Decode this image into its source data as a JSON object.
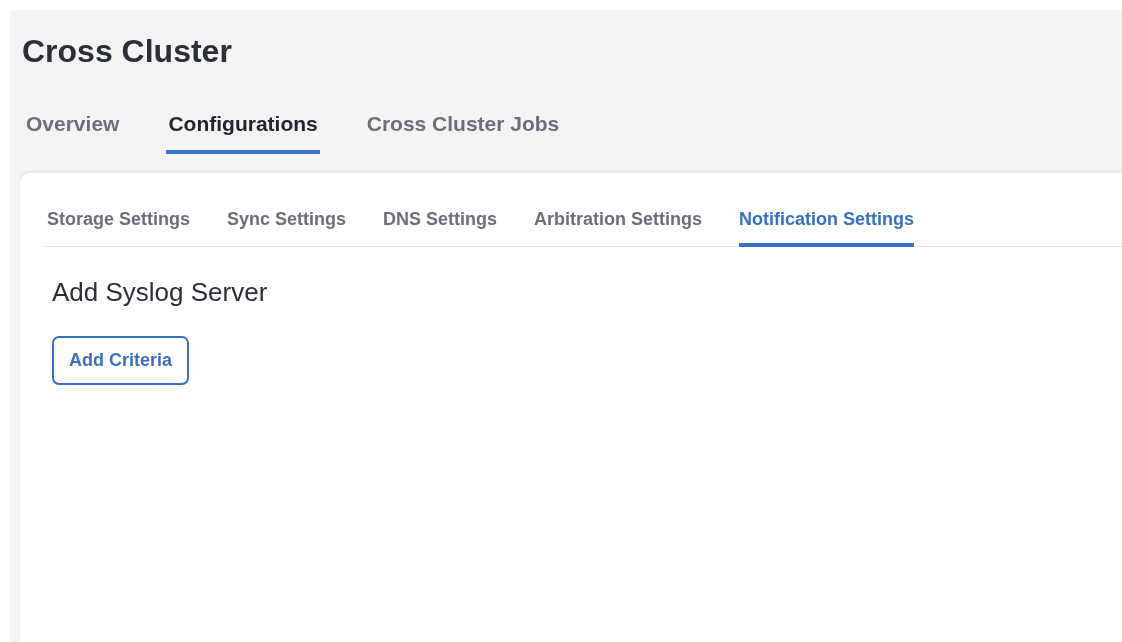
{
  "title": "Cross Cluster",
  "tabs": [
    {
      "label": "Overview",
      "selected": false
    },
    {
      "label": "Configurations",
      "selected": true
    },
    {
      "label": "Cross Cluster Jobs",
      "selected": false
    }
  ],
  "sub_tabs": [
    {
      "label": "Storage Settings",
      "selected": false
    },
    {
      "label": "Sync Settings",
      "selected": false
    },
    {
      "label": "DNS Settings",
      "selected": false
    },
    {
      "label": "Arbitration Settings",
      "selected": false
    },
    {
      "label": "Notification Settings",
      "selected": true
    }
  ],
  "section_title": "Add Syslog Server",
  "button": "Add Criteria"
}
